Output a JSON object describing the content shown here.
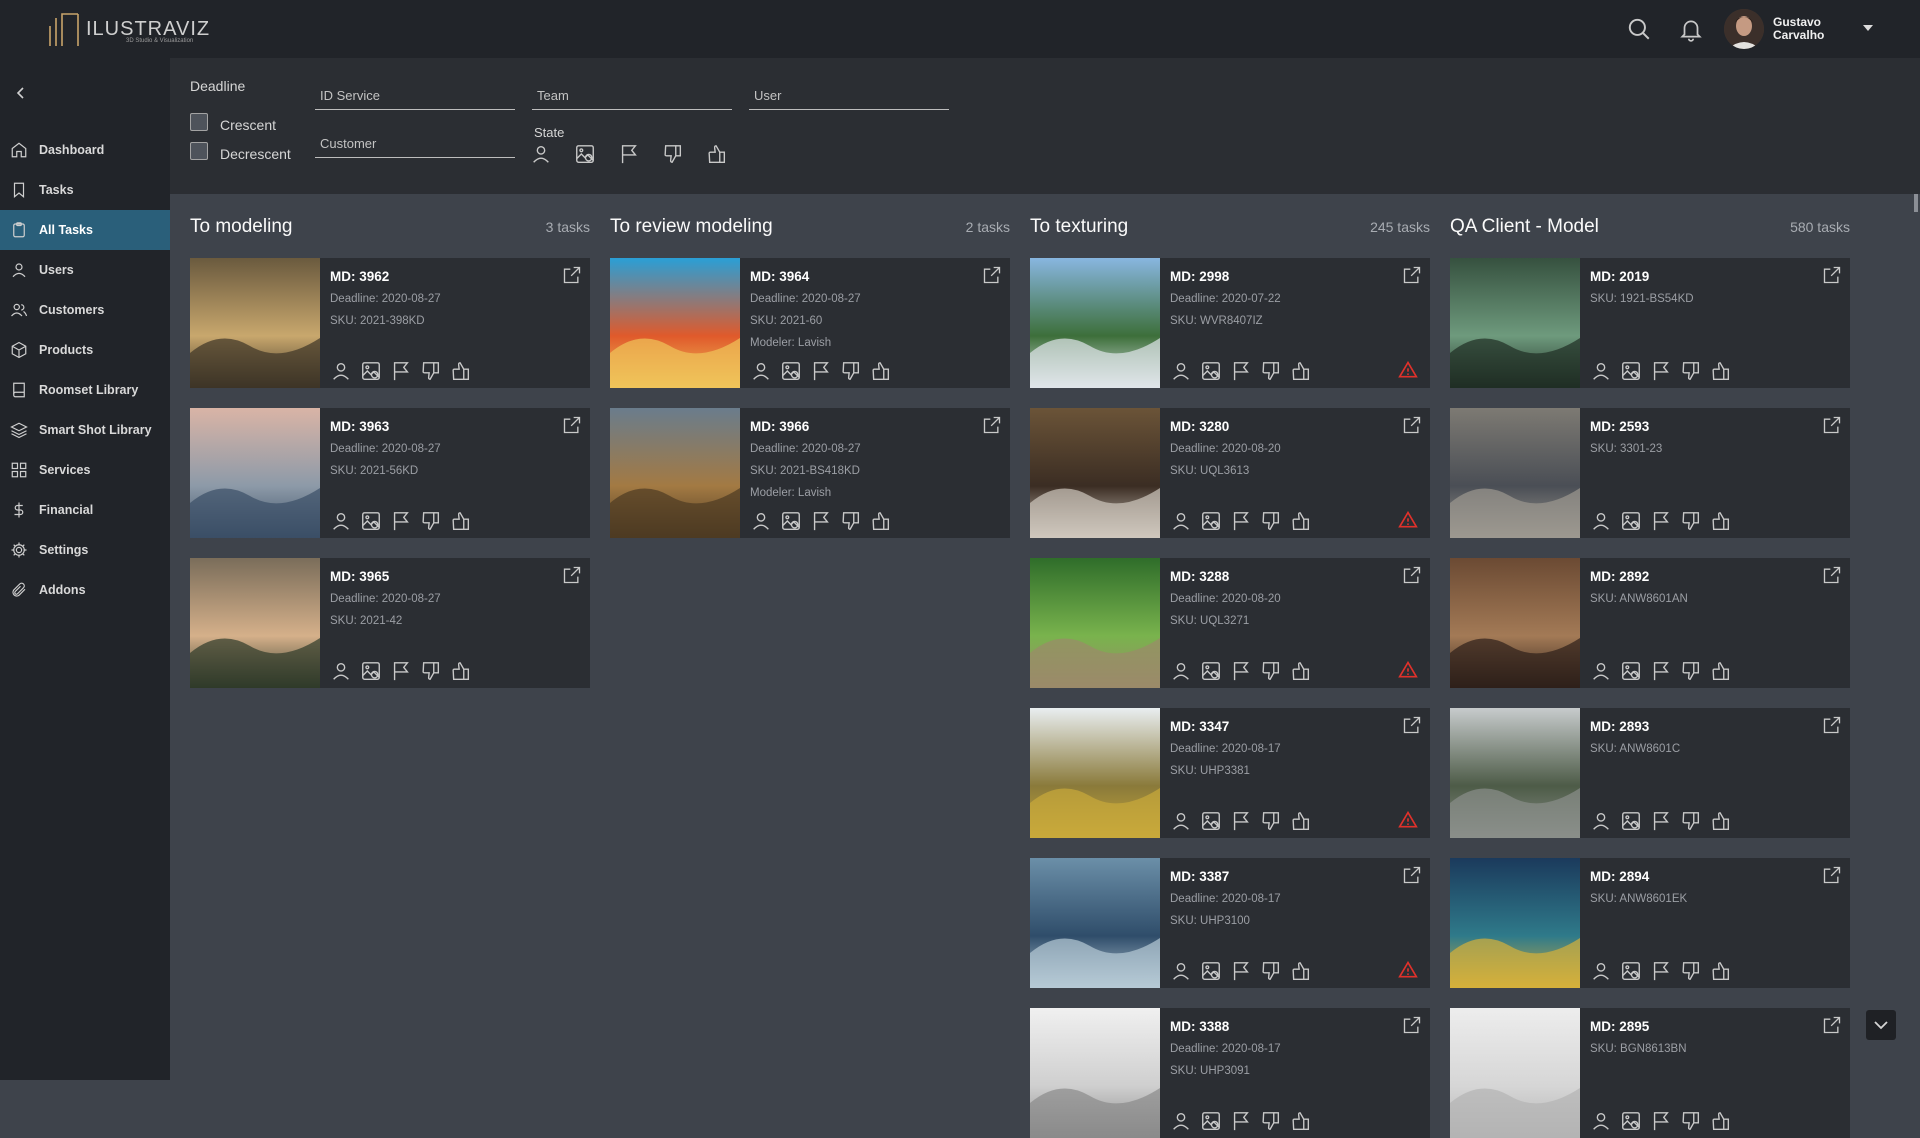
{
  "brand": {
    "name": "ILUSTRAVIZ",
    "tagline": "3D Studio & Visualization"
  },
  "user": {
    "name": "Gustavo Carvalho"
  },
  "icons": {
    "search": "search-icon",
    "notifications": "bell-icon",
    "dropdown": "caret-down-icon"
  },
  "nav": {
    "items": [
      {
        "label": "Dashboard",
        "icon": "home-icon"
      },
      {
        "label": "Tasks",
        "icon": "bookmark-icon"
      },
      {
        "label": "All Tasks",
        "icon": "clipboard-icon",
        "active": true
      },
      {
        "label": "Users",
        "icon": "user-icon"
      },
      {
        "label": "Customers",
        "icon": "users-icon"
      },
      {
        "label": "Products",
        "icon": "box-icon"
      },
      {
        "label": "Roomset Library",
        "icon": "book-icon"
      },
      {
        "label": "Smart Shot Library",
        "icon": "layers-icon"
      },
      {
        "label": "Services",
        "icon": "grid-icon"
      },
      {
        "label": "Financial",
        "icon": "dollar-icon"
      },
      {
        "label": "Settings",
        "icon": "gear-icon"
      },
      {
        "label": "Addons",
        "icon": "paperclip-icon"
      }
    ]
  },
  "filters": {
    "deadline_label": "Deadline",
    "crescent": "Crescent",
    "decrescent": "Decrescent",
    "id_service": {
      "placeholder": "ID Service",
      "value": ""
    },
    "team": {
      "placeholder": "Team",
      "value": ""
    },
    "user": {
      "placeholder": "User",
      "value": ""
    },
    "customer": {
      "placeholder": "Customer",
      "value": ""
    },
    "state_label": "State"
  },
  "accent": "#2a5f7a",
  "warning_color": "#e0312b",
  "columns": [
    {
      "title": "To modeling",
      "count": "3 tasks",
      "cards": [
        {
          "md": "MD: 3962",
          "deadline": "Deadline: 2020-08-27",
          "sku": "SKU: 2021-398KD",
          "extra": "",
          "warning": false
        },
        {
          "md": "MD: 3963",
          "deadline": "Deadline: 2020-08-27",
          "sku": "SKU: 2021-56KD",
          "extra": "",
          "warning": false
        },
        {
          "md": "MD: 3965",
          "deadline": "Deadline: 2020-08-27",
          "sku": "SKU: 2021-42",
          "extra": "",
          "warning": false
        }
      ]
    },
    {
      "title": "To review modeling",
      "count": "2 tasks",
      "cards": [
        {
          "md": "MD: 3964",
          "deadline": "Deadline: 2020-08-27",
          "sku": "SKU: 2021-60",
          "extra": "Modeler: Lavish",
          "warning": false
        },
        {
          "md": "MD: 3966",
          "deadline": "Deadline: 2020-08-27",
          "sku": "SKU: 2021-BS418KD",
          "extra": "Modeler: Lavish",
          "warning": false
        }
      ]
    },
    {
      "title": "To texturing",
      "count": "245 tasks",
      "cards": [
        {
          "md": "MD: 2998",
          "deadline": "Deadline: 2020-07-22",
          "sku": "SKU: WVR8407IZ",
          "extra": "",
          "warning": true
        },
        {
          "md": "MD: 3280",
          "deadline": "Deadline: 2020-08-20",
          "sku": "SKU: UQL3613",
          "extra": "",
          "warning": true
        },
        {
          "md": "MD: 3288",
          "deadline": "Deadline: 2020-08-20",
          "sku": "SKU: UQL3271",
          "extra": "",
          "warning": true
        },
        {
          "md": "MD: 3347",
          "deadline": "Deadline: 2020-08-17",
          "sku": "SKU: UHP3381",
          "extra": "",
          "warning": true
        },
        {
          "md": "MD: 3387",
          "deadline": "Deadline: 2020-08-17",
          "sku": "SKU: UHP3100",
          "extra": "",
          "warning": true
        },
        {
          "md": "MD: 3388",
          "deadline": "Deadline: 2020-08-17",
          "sku": "SKU: UHP3091",
          "extra": "",
          "warning": false
        }
      ]
    },
    {
      "title": "QA Client - Model",
      "count": "580 tasks",
      "cards": [
        {
          "md": "MD: 2019",
          "deadline": "SKU: 1921-BS54KD",
          "sku": "",
          "extra": "",
          "warning": false
        },
        {
          "md": "MD: 2593",
          "deadline": "SKU: 3301-23",
          "sku": "",
          "extra": "",
          "warning": false
        },
        {
          "md": "MD: 2892",
          "deadline": "SKU: ANW8601AN",
          "sku": "",
          "extra": "",
          "warning": false
        },
        {
          "md": "MD: 2893",
          "deadline": "SKU: ANW8601C",
          "sku": "",
          "extra": "",
          "warning": false
        },
        {
          "md": "MD: 2894",
          "deadline": "SKU: ANW8601EK",
          "sku": "",
          "extra": "",
          "warning": false
        },
        {
          "md": "MD: 2895",
          "deadline": "SKU: BGN8613BN",
          "sku": "",
          "extra": "",
          "warning": false
        }
      ]
    }
  ]
}
